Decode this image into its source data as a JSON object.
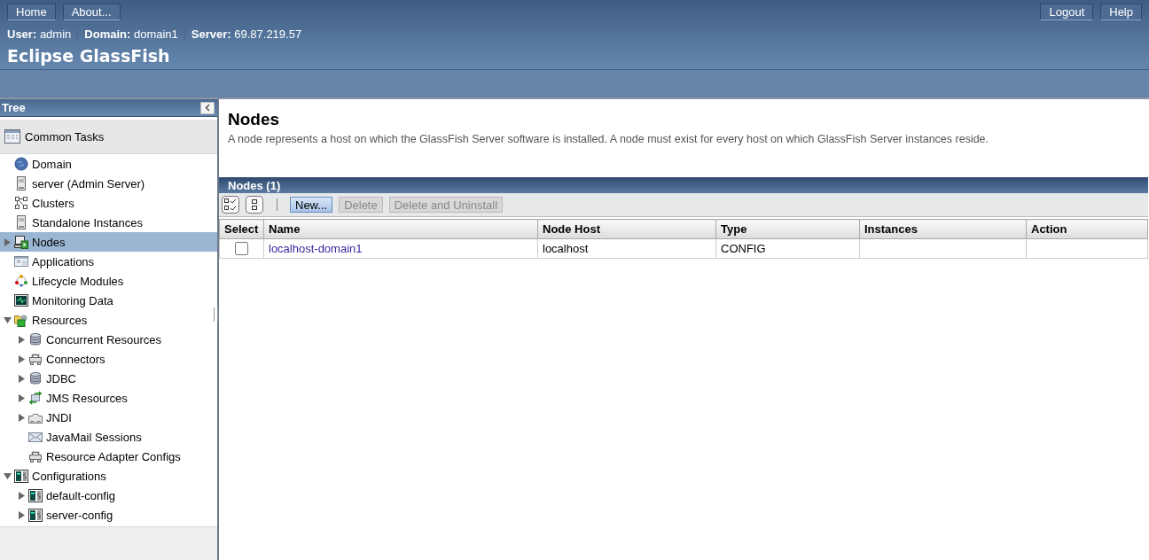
{
  "header": {
    "left_buttons": [
      "Home",
      "About..."
    ],
    "right_buttons": [
      "Logout",
      "Help"
    ],
    "info": [
      {
        "label": "User:",
        "value": "admin"
      },
      {
        "label": "Domain:",
        "value": "domain1"
      },
      {
        "label": "Server:",
        "value": "69.87.219.57"
      }
    ],
    "product_name": "Eclipse GlassFish"
  },
  "sidebar": {
    "title": "Tree",
    "common_tasks": "Common Tasks",
    "items": [
      {
        "label": "Domain",
        "kind": "globe",
        "selected": false
      },
      {
        "label": "server (Admin Server)",
        "kind": "server",
        "selected": false
      },
      {
        "label": "Clusters",
        "kind": "cluster",
        "selected": false
      },
      {
        "label": "Standalone Instances",
        "kind": "server",
        "selected": false
      },
      {
        "label": "Nodes",
        "kind": "node",
        "selected": true,
        "expanded": false
      },
      {
        "label": "Applications",
        "kind": "app",
        "selected": false
      },
      {
        "label": "Lifecycle Modules",
        "kind": "lifecycle",
        "selected": false
      },
      {
        "label": "Monitoring Data",
        "kind": "monitor",
        "selected": false
      },
      {
        "label": "Resources",
        "kind": "resources",
        "selected": false,
        "expanded": true,
        "children": [
          {
            "label": "Concurrent Resources",
            "kind": "database",
            "selected": false,
            "expanded": false
          },
          {
            "label": "Connectors",
            "kind": "connector",
            "selected": false,
            "expanded": false
          },
          {
            "label": "JDBC",
            "kind": "database",
            "selected": false,
            "expanded": false
          },
          {
            "label": "JMS Resources",
            "kind": "jms",
            "selected": false,
            "expanded": false
          },
          {
            "label": "JNDI",
            "kind": "jndi",
            "selected": false,
            "expanded": false
          },
          {
            "label": "JavaMail Sessions",
            "kind": "mail",
            "selected": false
          },
          {
            "label": "Resource Adapter Configs",
            "kind": "connector",
            "selected": false
          }
        ]
      },
      {
        "label": "Configurations",
        "kind": "config",
        "selected": false,
        "expanded": true,
        "children": [
          {
            "label": "default-config",
            "kind": "config",
            "selected": false,
            "expanded": false
          },
          {
            "label": "server-config",
            "kind": "config",
            "selected": false,
            "expanded": false
          }
        ]
      }
    ]
  },
  "page": {
    "title": "Nodes",
    "description": "A node represents a host on which the GlassFish Server software is installed. A node must exist for every host on which GlassFish Server instances reside."
  },
  "table": {
    "title": "Nodes (1)",
    "buttons": [
      {
        "label": "New...",
        "disabled": false
      },
      {
        "label": "Delete",
        "disabled": true
      },
      {
        "label": "Delete and Uninstall",
        "disabled": true
      }
    ],
    "columns": [
      "Select",
      "Name",
      "Node Host",
      "Type",
      "Instances",
      "Action"
    ],
    "rows": [
      {
        "checked": false,
        "name": "localhost-domain1",
        "node_host": "localhost",
        "type": "CONFIG"
      }
    ]
  }
}
